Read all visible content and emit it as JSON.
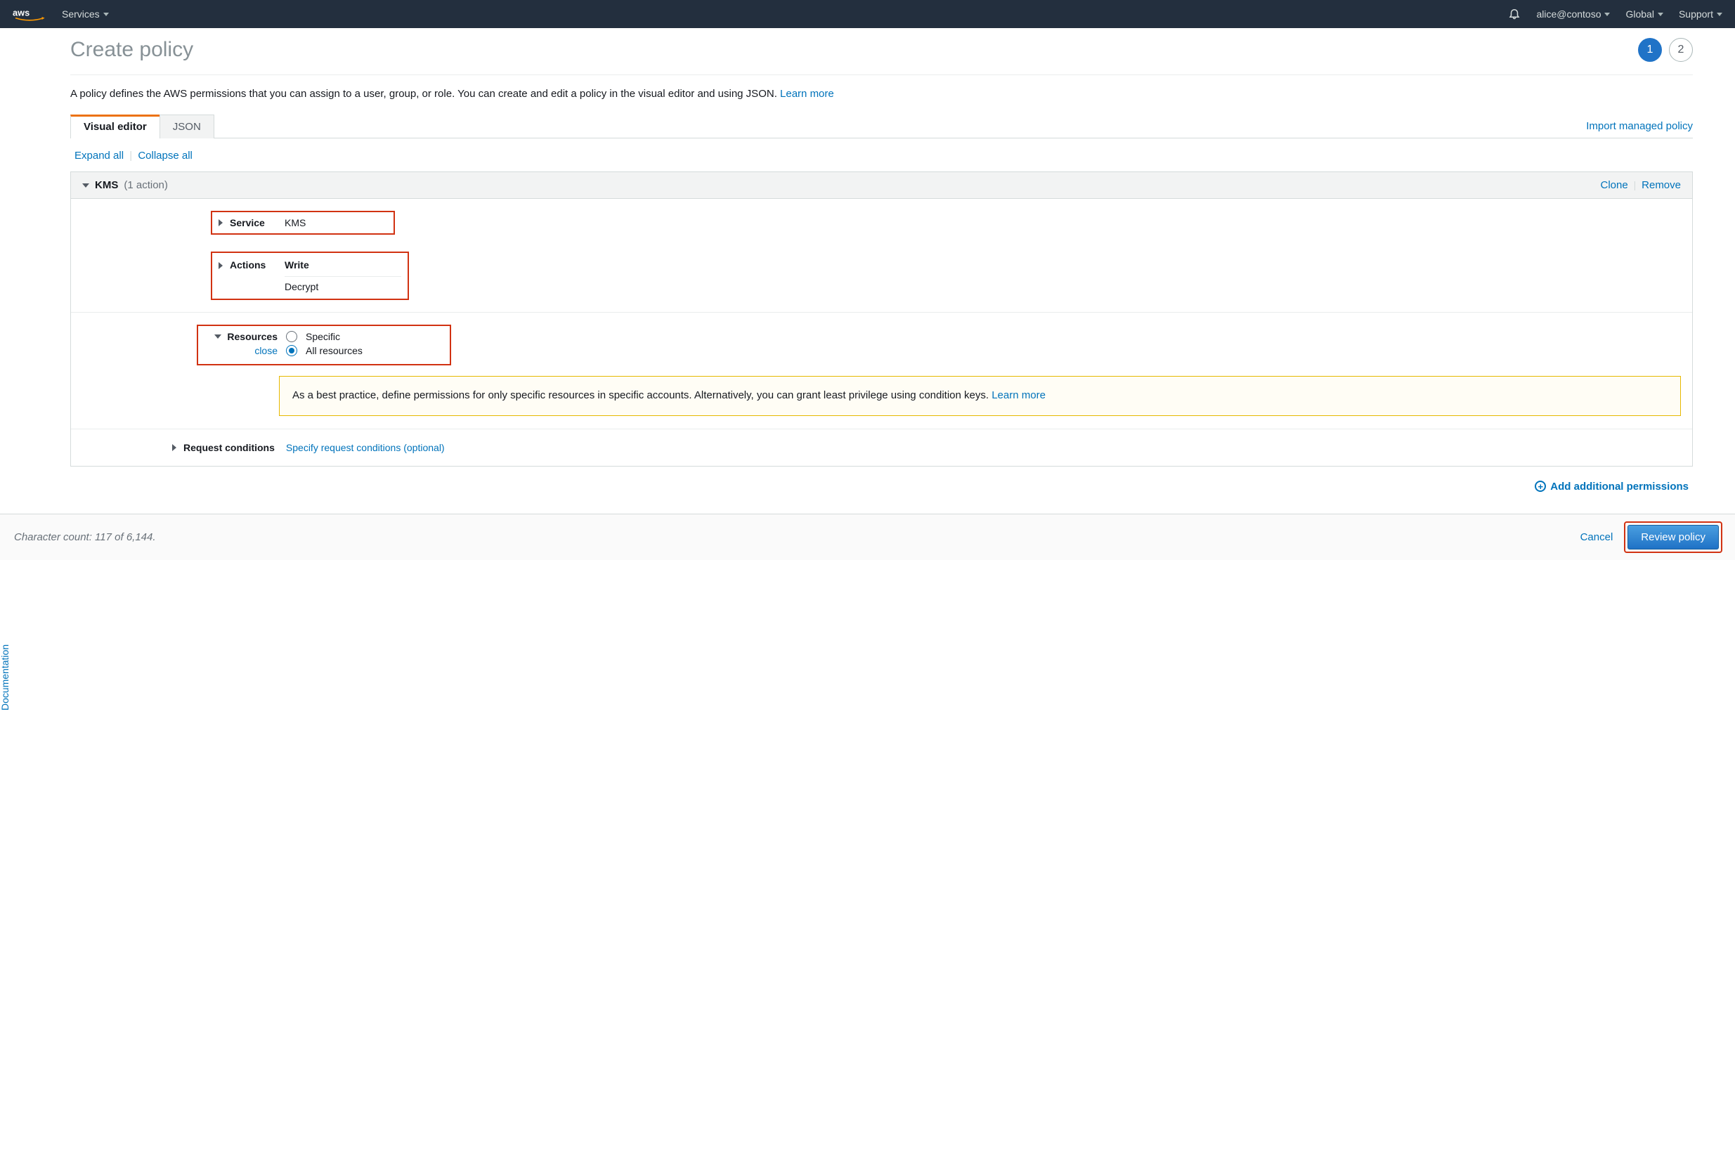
{
  "topnav": {
    "services": "Services",
    "user": "alice@contoso",
    "region": "Global",
    "support": "Support"
  },
  "doc_tab": "Documentation",
  "header": {
    "title": "Create policy",
    "step1": "1",
    "step2": "2"
  },
  "intro": {
    "text": "A policy defines the AWS permissions that you can assign to a user, group, or role. You can create and edit a policy in the visual editor and using JSON. ",
    "learn_more": "Learn more"
  },
  "tabs": {
    "visual": "Visual editor",
    "json": "JSON"
  },
  "import_link": "Import managed policy",
  "expand": {
    "expand_all": "Expand all",
    "collapse_all": "Collapse all"
  },
  "block": {
    "service": "KMS",
    "count": "(1 action)",
    "clone": "Clone",
    "remove": "Remove"
  },
  "section_service": {
    "label": "Service",
    "value": "KMS"
  },
  "section_actions": {
    "label": "Actions",
    "value1": "Write",
    "value2": "Decrypt"
  },
  "section_resources": {
    "label": "Resources",
    "close": "close",
    "opt_specific": "Specific",
    "opt_all": "All resources",
    "warn_text": "As a best practice, define permissions for only specific resources in specific accounts. Alternatively, you can grant least privilege using condition keys. ",
    "warn_link": "Learn more"
  },
  "section_conditions": {
    "label": "Request conditions",
    "value": "Specify request conditions (optional)"
  },
  "add_perm": "Add additional permissions",
  "footer": {
    "char_count": "Character count: 117 of 6,144.",
    "cancel": "Cancel",
    "review": "Review policy"
  }
}
